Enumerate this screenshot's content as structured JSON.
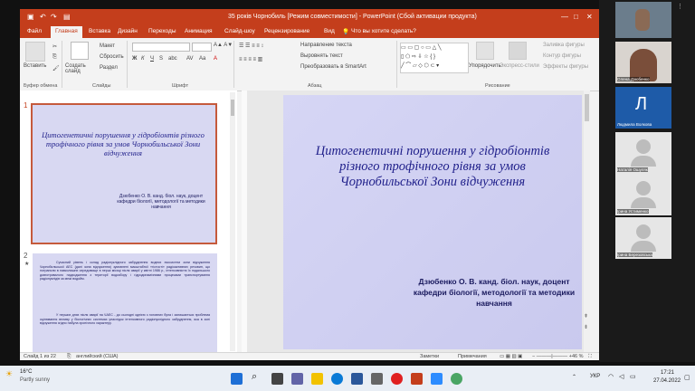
{
  "window": {
    "title": "35 років Чорнобиль [Режим совместимости] - PowerPoint (Сбой активации продукта)"
  },
  "ribbon_tabs": [
    "Файл",
    "Главная",
    "Вставка",
    "Дизайн",
    "Переходы",
    "Анимация",
    "Слайд-шоу",
    "Рецензирование",
    "Вид"
  ],
  "active_tab": "Главная",
  "search_hint": "Что вы хотите сделать?",
  "ribbon": {
    "paste": "Вставить",
    "create_slide": "Создать слайд",
    "layout": "Макет",
    "reset": "Сбросить",
    "section": "Раздел",
    "text_direction": "Направление текста",
    "align_text": "Выровнять текст",
    "convert_smartart": "Преобразовать в SmartArt",
    "arrange": "Упорядочить",
    "express_styles": "Экспресс-стили",
    "fill": "Заливка фигуры",
    "outline": "Контур фигуры",
    "effects": "Эффекты фигуры",
    "groups": {
      "clipboard": "Буфер обмена",
      "slides": "Слайды",
      "font": "Шрифт",
      "paragraph": "Абзац",
      "drawing": "Рисование"
    }
  },
  "slides": [
    {
      "number": "1",
      "title": "Цитогенетичні порушення у гідробіонтів різного трофічного рівня за умов Чорнобильської Зони відчуження",
      "author": "Дзюбенко О. В. канд. біол. наук, доцент кафедри біології, методології та методики навчання"
    },
    {
      "number": "2",
      "para1": "Сучасний рівень і склад радіонуклідного забруднення водних екосистем зони відчуження Чорнобильської АЕС (далі зона відчуження) зумовлені масштабної «гістості» радіоактивних речовин, що потрапили в навколишнє середовище в перші місяці після аварії у квітні 1986 р., інтенсивністю їх подальшого довготривалого надходження з території водозбору і гідродинамічними процесами транспортування радіонуклідів за межі водойм.",
      "para2": "У перших днях після аварії на ЧАЕС - до сьогодні однією з головних була і залишається проблема оцінювання впливу у біологічних системах унаслідок інтенсивного радіонуклідного забруднення, яка в зоні відчуження згідно набула хронічного характеру."
    }
  ],
  "status": {
    "slide_counter": "Слайд 1 из 22",
    "language": "английский (США)",
    "notes": "Заметки",
    "comments": "Примечания",
    "zoom": "46 %"
  },
  "participants": [
    {
      "name": "Олена Дзюбенко"
    },
    {
      "name": "Людмила Волкова",
      "initial": "Л"
    },
    {
      "name": "Наталія Ошуляк"
    },
    {
      "name": "Ірина Устименко"
    },
    {
      "name": "Ірина Березовська"
    }
  ],
  "taskbar": {
    "weather_temp": "16°C",
    "weather_desc": "Partly sunny",
    "lang": "УКР",
    "time": "17:21",
    "date": "27.04.2022"
  },
  "colors": {
    "accent": "#c43e1c",
    "slide_bg": "#d6d6f5",
    "title_text": "#1f1f8a"
  }
}
